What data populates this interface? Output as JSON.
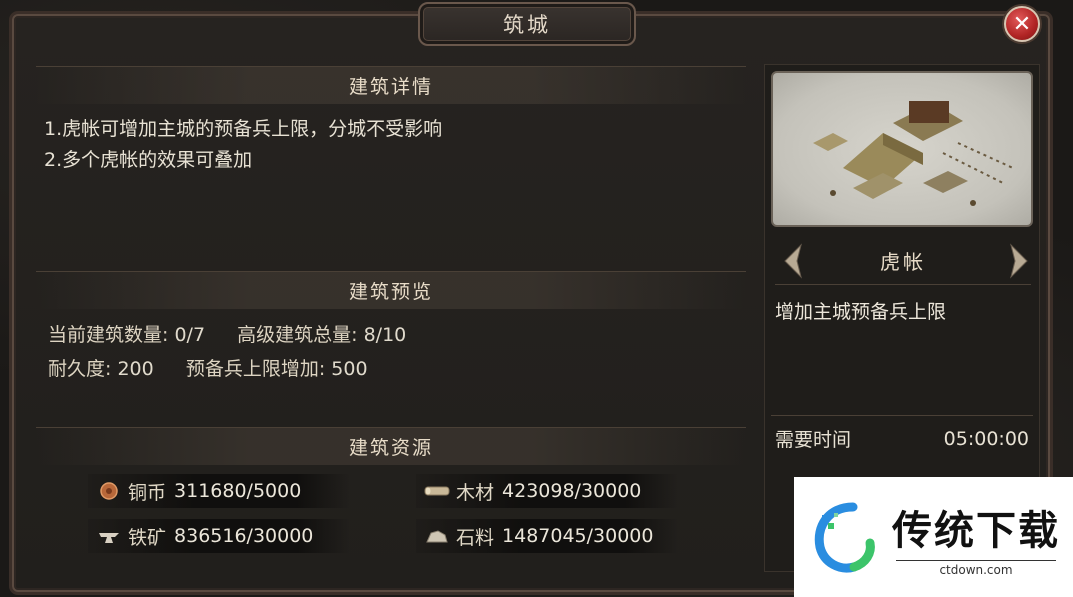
{
  "window": {
    "title": "筑城",
    "close_icon": "close-icon"
  },
  "details": {
    "heading": "建筑详情",
    "lines": [
      "1.虎帐可增加主城的预备兵上限，分城不受影响",
      "2.多个虎帐的效果可叠加"
    ]
  },
  "preview": {
    "heading": "建筑预览",
    "current_count_label": "当前建筑数量:",
    "current_count_value": "0/7",
    "advanced_total_label": "高级建筑总量:",
    "advanced_total_value": "8/10",
    "durability_label": "耐久度:",
    "durability_value": "200",
    "reserve_label": "预备兵上限增加:",
    "reserve_value": "500"
  },
  "resources": {
    "heading": "建筑资源",
    "items": [
      {
        "icon": "copper-coin-icon",
        "name": "铜币",
        "value": "311680/5000"
      },
      {
        "icon": "wood-icon",
        "name": "木材",
        "value": "423098/30000"
      },
      {
        "icon": "iron-ore-icon",
        "name": "铁矿",
        "value": "836516/30000"
      },
      {
        "icon": "stone-icon",
        "name": "石料",
        "value": "1487045/30000"
      }
    ]
  },
  "building": {
    "name": "虎帐",
    "effect": "增加主城预备兵上限",
    "time_label": "需要时间",
    "time_value": "05:00:00"
  },
  "watermark": {
    "brand": "传统下载",
    "url": "ctdown.com"
  },
  "colors": {
    "accent_close": "#b02424",
    "brand_blue": "#2a8de0",
    "brand_green": "#3cc46a"
  }
}
